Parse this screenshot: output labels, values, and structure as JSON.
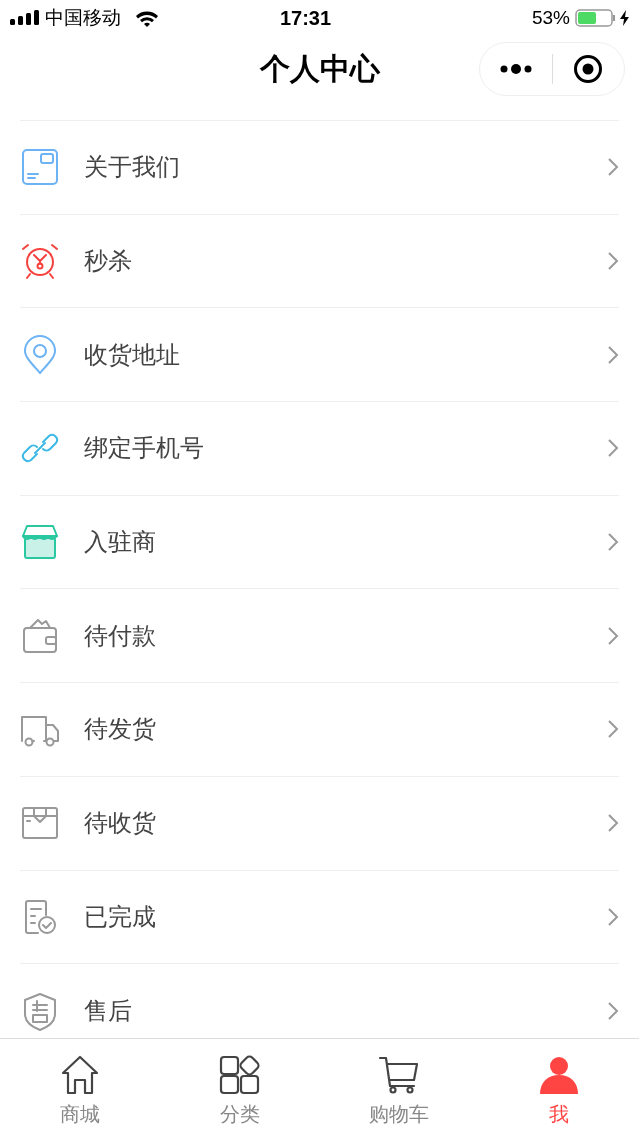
{
  "status_bar": {
    "carrier": "中国移动",
    "time": "17:31",
    "battery": "53%"
  },
  "nav": {
    "title": "个人中心"
  },
  "menu": [
    {
      "kind": "card",
      "label": "关于我们",
      "color": "#6cb3f5"
    },
    {
      "kind": "alarm",
      "label": "秒杀",
      "color": "#f5423f"
    },
    {
      "kind": "pin",
      "label": "收货地址",
      "color": "#6cb3f5"
    },
    {
      "kind": "link",
      "label": "绑定手机号",
      "color": "#3bb8e6"
    },
    {
      "kind": "shop",
      "label": "入驻商",
      "color": "#2ac8a0"
    },
    {
      "kind": "wallet",
      "label": "待付款",
      "color": "#999999"
    },
    {
      "kind": "truck",
      "label": "待发货",
      "color": "#999999"
    },
    {
      "kind": "box",
      "label": "待收货",
      "color": "#999999"
    },
    {
      "kind": "done",
      "label": "已完成",
      "color": "#999999"
    },
    {
      "kind": "shield",
      "label": "售后",
      "color": "#999999"
    }
  ],
  "tabs": [
    {
      "kind": "home",
      "label": "商城",
      "selected": false
    },
    {
      "kind": "grid",
      "label": "分类",
      "selected": false
    },
    {
      "kind": "cart",
      "label": "购物车",
      "selected": false
    },
    {
      "kind": "user",
      "label": "我",
      "selected": true
    }
  ]
}
